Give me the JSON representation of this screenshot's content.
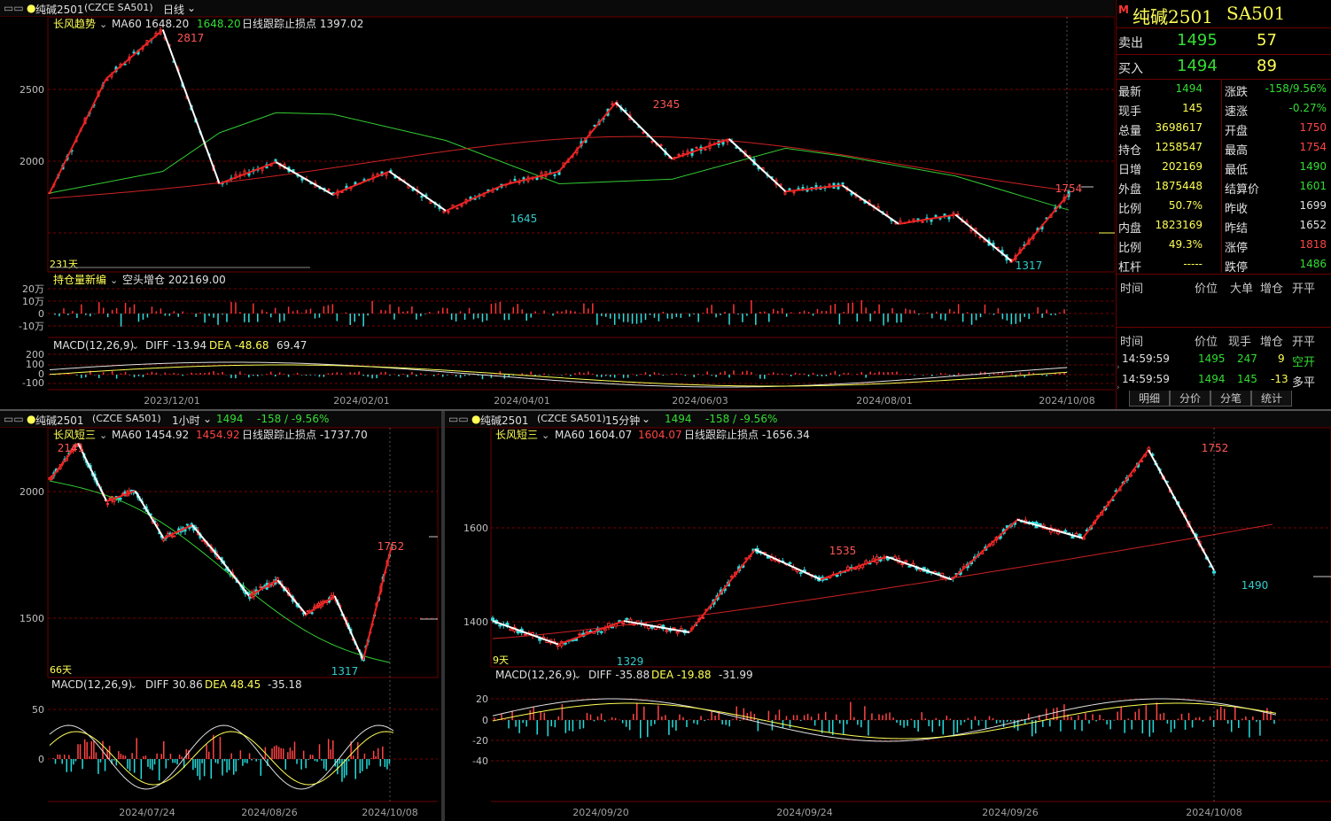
{
  "top_header": {
    "symbol": "纯碱2501",
    "market_code": "(CZCE SA501)",
    "period": "日线",
    "marker": "M"
  },
  "main_chart": {
    "indicator_name": "长风趋势",
    "ma_label": "MA60 1648.20",
    "ma_value": "1648.20",
    "stop_label": "日线跟踪止损点 1397.02",
    "y_ticks": [
      "2500",
      "2000"
    ],
    "peak_labels": [
      "2817",
      "2345",
      "1754"
    ],
    "trough_labels": [
      "1645",
      "1317"
    ],
    "days_label": "231天",
    "x_labels": [
      "2023/12/01",
      "2024/02/01",
      "2024/04/01",
      "2024/06/03",
      "2024/08/01",
      "2024/10/08"
    ]
  },
  "oi_panel": {
    "indicator_name": "持仓量新编",
    "label": "空头增仓 202169.00",
    "y_ticks": [
      "20万",
      "10万",
      "0",
      "-10万"
    ]
  },
  "macd_main": {
    "name": "MACD(12,26,9)",
    "diff": "DIFF -13.94",
    "dea": "DEA -48.68",
    "macd": "69.47",
    "y_ticks": [
      "200",
      "100",
      "0",
      "-100"
    ]
  },
  "quote": {
    "marker": "M",
    "title": "纯碱2501",
    "code": "SA501",
    "sell_label": "卖出",
    "sell_price": "1495",
    "sell_vol": "57",
    "buy_label": "买入",
    "buy_price": "1494",
    "buy_vol": "89",
    "rows": [
      {
        "l1": "最新",
        "v1": "1494",
        "l2": "涨跌",
        "v2": "-158/9.56%"
      },
      {
        "l1": "现手",
        "v1": "145",
        "l2": "速涨",
        "v2": "-0.27%"
      },
      {
        "l1": "总量",
        "v1": "3698617",
        "l2": "开盘",
        "v2": "1750"
      },
      {
        "l1": "持仓",
        "v1": "1258547",
        "l2": "最高",
        "v2": "1754"
      },
      {
        "l1": "日增",
        "v1": "202169",
        "l2": "最低",
        "v2": "1490"
      },
      {
        "l1": "外盘",
        "v1": "1875448",
        "l2": "结算价",
        "v2": "1601"
      },
      {
        "l1": "比例",
        "v1": "50.7%",
        "l2": "昨收",
        "v2": "1699"
      },
      {
        "l1": "内盘",
        "v1": "1823169",
        "l2": "昨结",
        "v2": "1652"
      },
      {
        "l1": "比例",
        "v1": "49.3%",
        "l2": "涨停",
        "v2": "1818"
      },
      {
        "l1": "杠杆",
        "v1": "-----",
        "l2": "跌停",
        "v2": "1486"
      }
    ],
    "big_header": {
      "c1": "时间",
      "c2": "价位",
      "c3": "大单",
      "c4": "增仓",
      "c5": "开平"
    },
    "tick_header": {
      "c1": "时间",
      "c2": "价位",
      "c3": "现手",
      "c4": "增仓",
      "c5": "开平"
    },
    "ticks": [
      {
        "time": "14:59:59",
        "price": "1495",
        "vol": "247",
        "oi": "9",
        "type": "空开"
      },
      {
        "time": "14:59:59",
        "price": "1494",
        "vol": "145",
        "oi": "-13",
        "type": "多平"
      }
    ],
    "tabs": [
      "明细",
      "分价",
      "分笔",
      "统计"
    ]
  },
  "hour_chart": {
    "symbol": "纯碱2501",
    "market_code": "(CZCE SA501)",
    "period": "1小时",
    "last": "1494",
    "change": "-158 / -9.56%",
    "indicator_name": "长风短三",
    "ma_label": "MA60 1454.92",
    "ma_value": "1454.92",
    "stop_label": "日线跟踪止损点 -1737.70",
    "y_ticks": [
      "2000",
      "1500"
    ],
    "peak_labels": [
      "2141",
      "1752"
    ],
    "trough_labels": [
      "1317"
    ],
    "days_label": "66天",
    "macd_name": "MACD(12,26,9)",
    "macd_diff": "DIFF 30.86",
    "macd_dea": "DEA 48.45",
    "macd_val": "-35.18",
    "macd_ticks": [
      "50",
      "0"
    ],
    "x_labels": [
      "2024/07/24",
      "2024/08/26",
      "2024/10/08"
    ]
  },
  "min_chart": {
    "symbol": "纯碱2501",
    "market_code": "(CZCE SA501)",
    "period": "15分钟",
    "last": "1494",
    "change": "-158 / -9.56%",
    "indicator_name": "长风短三",
    "ma_label": "MA60 1604.07",
    "ma_value": "1604.07",
    "stop_label": "日线跟踪止损点 -1656.34",
    "y_ticks": [
      "1600",
      "1400"
    ],
    "peak_labels": [
      "1752",
      "1535"
    ],
    "trough_labels": [
      "1329",
      "1490"
    ],
    "days_label": "9天",
    "macd_name": "MACD(12,26,9)",
    "macd_diff": "DIFF -35.88",
    "macd_dea": "DEA -19.88",
    "macd_val": "-31.99",
    "macd_ticks": [
      "20",
      "0",
      "-20",
      "-40"
    ],
    "x_labels": [
      "2024/09/20",
      "2024/09/24",
      "2024/09/26",
      "2024/10/08"
    ]
  },
  "chart_data": [
    {
      "type": "line",
      "title": "纯碱2501 日线",
      "ylim": [
        1250,
        2900
      ],
      "series": [
        {
          "name": "长风趋势",
          "points": [
            [
              0,
              1760
            ],
            [
              1,
              2500
            ],
            [
              2,
              2817
            ],
            [
              3,
              1820
            ],
            [
              4,
              1960
            ],
            [
              5,
              1750
            ],
            [
              6,
              1900
            ],
            [
              7,
              1645
            ],
            [
              8,
              1810
            ],
            [
              9,
              1900
            ],
            [
              10,
              2345
            ],
            [
              11,
              1980
            ],
            [
              12,
              2110
            ],
            [
              13,
              1770
            ],
            [
              14,
              1810
            ],
            [
              15,
              1560
            ],
            [
              16,
              1620
            ],
            [
              17,
              1317
            ],
            [
              18,
              1754
            ]
          ]
        },
        {
          "name": "MA60",
          "points": [
            [
              0,
              1760
            ],
            [
              2,
              1900
            ],
            [
              3,
              2150
            ],
            [
              4,
              2280
            ],
            [
              5,
              2270
            ],
            [
              7,
              2100
            ],
            [
              9,
              1820
            ],
            [
              11,
              1850
            ],
            [
              13,
              2050
            ],
            [
              14,
              2000
            ],
            [
              16,
              1870
            ],
            [
              18,
              1650
            ]
          ]
        }
      ]
    },
    {
      "type": "line",
      "title": "纯碱2501 1小时",
      "ylim": [
        1250,
        2200
      ],
      "series": [
        {
          "name": "长风短三",
          "points": [
            [
              0,
              2000
            ],
            [
              1,
              2141
            ],
            [
              2,
              1920
            ],
            [
              3,
              1960
            ],
            [
              4,
              1780
            ],
            [
              5,
              1830
            ],
            [
              6,
              1700
            ],
            [
              7,
              1560
            ],
            [
              8,
              1620
            ],
            [
              9,
              1490
            ],
            [
              10,
              1560
            ],
            [
              11,
              1317
            ],
            [
              12,
              1752
            ]
          ]
        }
      ]
    },
    {
      "type": "line",
      "title": "纯碱2501 15分钟",
      "ylim": [
        1280,
        1800
      ],
      "series": [
        {
          "name": "长风短三",
          "points": [
            [
              0,
              1380
            ],
            [
              1,
              1329
            ],
            [
              2,
              1380
            ],
            [
              3,
              1355
            ],
            [
              4,
              1535
            ],
            [
              5,
              1470
            ],
            [
              6,
              1520
            ],
            [
              7,
              1470
            ],
            [
              8,
              1600
            ],
            [
              9,
              1560
            ],
            [
              10,
              1752
            ],
            [
              11,
              1490
            ]
          ]
        }
      ]
    }
  ]
}
